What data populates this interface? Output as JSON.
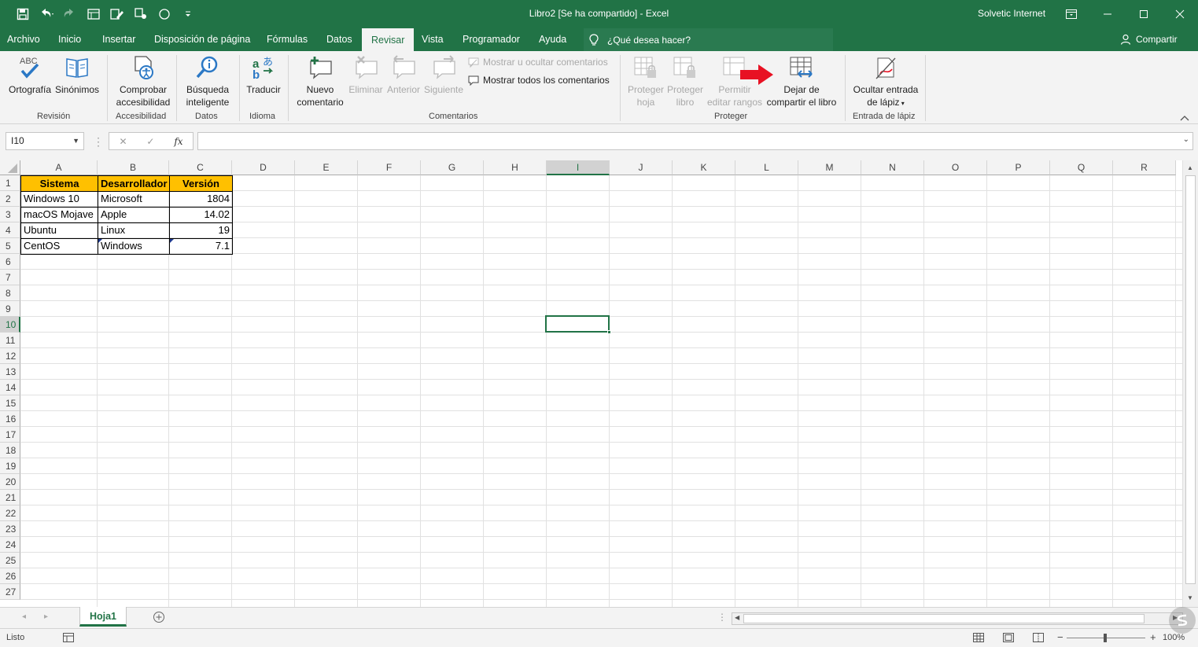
{
  "window": {
    "title": "Libro2  [Se ha compartido]  -  Excel",
    "user": "Solvetic Internet"
  },
  "tabs": [
    "Archivo",
    "Inicio",
    "Insertar",
    "Disposición de página",
    "Fórmulas",
    "Datos",
    "Revisar",
    "Vista",
    "Programador",
    "Ayuda"
  ],
  "active_tab": "Revisar",
  "tell_me": "¿Qué desea hacer?",
  "share": "Compartir",
  "ribbon": {
    "revision": {
      "spelling": "Ortografía",
      "synonyms": "Sinónimos",
      "label": "Revisión",
      "abc": "ABC"
    },
    "accesibilidad": {
      "check_1": "Comprobar",
      "check_2": "accesibilidad",
      "label": "Accesibilidad"
    },
    "datos": {
      "smart_1": "Búsqueda",
      "smart_2": "inteligente",
      "label": "Datos"
    },
    "idioma": {
      "translate": "Traducir",
      "label": "Idioma"
    },
    "comentarios": {
      "new_1": "Nuevo",
      "new_2": "comentario",
      "delete": "Eliminar",
      "previous": "Anterior",
      "next": "Siguiente",
      "show_hide": "Mostrar u ocultar comentarios",
      "show_all": "Mostrar todos los comentarios",
      "label": "Comentarios"
    },
    "proteger": {
      "sheet_1": "Proteger",
      "sheet_2": "hoja",
      "book_1": "Proteger",
      "book_2": "libro",
      "ranges_1": "Permitir",
      "ranges_2": "editar rangos",
      "unshare_1": "Dejar de",
      "unshare_2": "compartir el libro",
      "label": "Proteger"
    },
    "lapiz": {
      "hide_1": "Ocultar entrada",
      "hide_2": "de lápiz",
      "label": "Entrada de lápiz"
    }
  },
  "formula_bar": {
    "name_box": "I10",
    "fx": "fx",
    "formula": ""
  },
  "columns": [
    "A",
    "B",
    "C",
    "D",
    "E",
    "F",
    "G",
    "H",
    "I",
    "J",
    "K",
    "L",
    "M",
    "N",
    "O",
    "P",
    "Q",
    "R"
  ],
  "rows": [
    "1",
    "2",
    "3",
    "4",
    "5",
    "6",
    "7",
    "8",
    "9",
    "10",
    "11",
    "12",
    "13",
    "14",
    "15",
    "16",
    "17",
    "18",
    "19",
    "20",
    "21",
    "22",
    "23",
    "24",
    "25",
    "26",
    "27"
  ],
  "table": {
    "headers": [
      "Sistema",
      "Desarrollador",
      "Versión"
    ],
    "rows": [
      [
        "Windows 10",
        "Microsoft",
        "1804"
      ],
      [
        "macOS Mojave",
        "Apple",
        "14.02"
      ],
      [
        "Ubuntu",
        "Linux",
        "19"
      ],
      [
        "CentOS",
        "Windows",
        "7.1"
      ]
    ]
  },
  "selected_cell": "I10",
  "sheet_tab": "Hoja1",
  "status": {
    "ready": "Listo",
    "zoom": "100%"
  },
  "colors": {
    "accent": "#217346",
    "header_fill": "#ffc000",
    "arrow": "#e81123"
  }
}
